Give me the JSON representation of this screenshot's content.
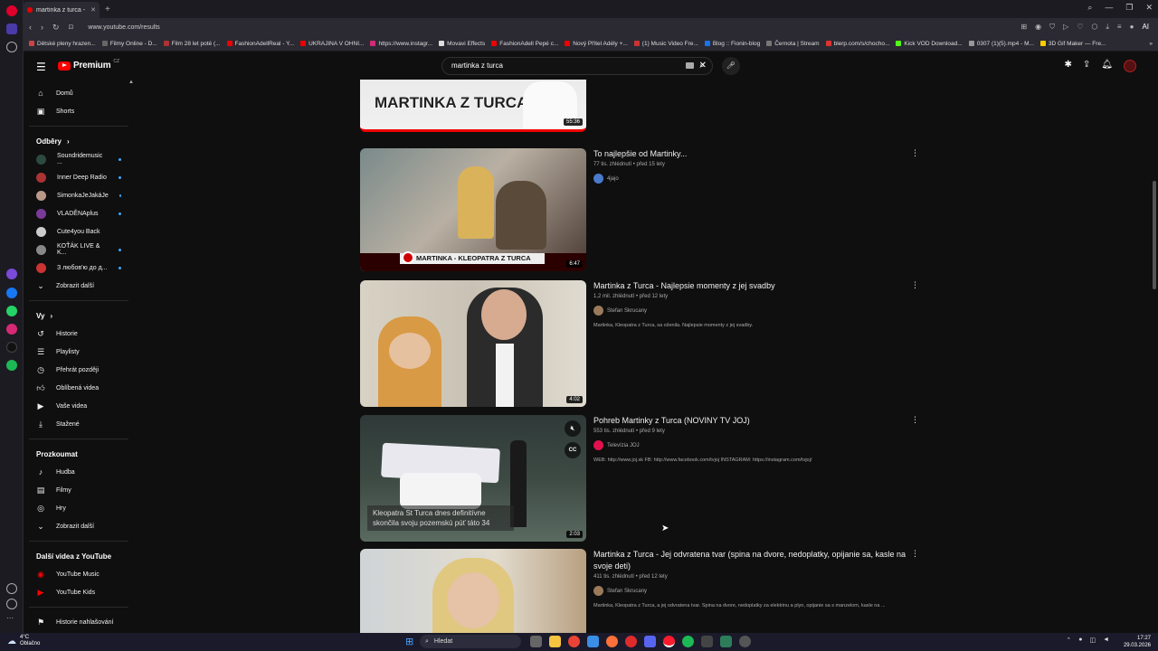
{
  "browser": {
    "tab_title": "martinka z turca - YouTub",
    "url": "www.youtube.com/results",
    "bookmarks": [
      "Dětské pleny hrazen...",
      "Filmy Online - D...",
      "Film 28 let poté (...",
      "FashionAdellReal - Y...",
      "UKRAJINA V OHNI...",
      "https://www.instagr...",
      "Movavi Effects",
      "FashionAdell Pepé c...",
      "Nový Přítel Adély +...",
      "(1) Music Video Fre...",
      "Blog :: Fionin-blog",
      "Černota | Stream",
      "blerp.com/s/chocho...",
      "Kick VOD Download...",
      "0307 (1)(5).mp4 - M...",
      "3D Gif Maker — Fre..."
    ]
  },
  "youtube": {
    "logo": "Premium",
    "logo_country": "CZ",
    "search_value": "martinka z turca"
  },
  "sidebar": {
    "main": [
      {
        "label": "Domů",
        "icon": "home-icon"
      },
      {
        "label": "Shorts",
        "icon": "shorts-icon"
      }
    ],
    "subs_heading": "Odběry",
    "subs": [
      {
        "label": "Soundridemusic ...",
        "color": "#2d4a3e"
      },
      {
        "label": "Inner Deep Radio",
        "color": "#a33"
      },
      {
        "label": "SimonkaJeJakáJe",
        "color": "#b98"
      },
      {
        "label": "VLADĚNAplus",
        "color": "#7a3a9a"
      },
      {
        "label": "Cute4you Back",
        "color": "#ccc"
      },
      {
        "label": "KOŤÁK LIVE & K...",
        "color": "#888"
      },
      {
        "label": "З любов'ю до д...",
        "color": "#c33"
      }
    ],
    "show_more": "Zobrazit další",
    "you_heading": "Vy",
    "you": [
      {
        "label": "Historie",
        "icon": "history-icon"
      },
      {
        "label": "Playlisty",
        "icon": "playlist-icon"
      },
      {
        "label": "Přehrát později",
        "icon": "clock-icon"
      },
      {
        "label": "Oblíbená videa",
        "icon": "like-icon"
      },
      {
        "label": "Vaše videa",
        "icon": "video-icon"
      },
      {
        "label": "Stažené",
        "icon": "download-icon"
      }
    ],
    "explore_heading": "Prozkoumat",
    "explore": [
      {
        "label": "Hudba",
        "icon": "music-icon"
      },
      {
        "label": "Filmy",
        "icon": "film-icon"
      },
      {
        "label": "Hry",
        "icon": "gamepad-icon"
      },
      {
        "label": "Zobrazit další",
        "icon": "chevron-down-icon"
      }
    ],
    "more_heading": "Další videa z YouTube",
    "more": [
      {
        "label": "YouTube Music",
        "icon": "yt-music-icon"
      },
      {
        "label": "YouTube Kids",
        "icon": "yt-kids-icon"
      }
    ],
    "report": "Historie nahlašování"
  },
  "results": [
    {
      "title": "",
      "stats": "",
      "channel": "",
      "desc": "",
      "duration": "55:36",
      "thumb_text": "MARTINKA Z TURCA"
    },
    {
      "title": "To najlepšie od Martinky...",
      "stats": "77 tis. zhlédnutí • před 15 lety",
      "channel": "4jajo",
      "desc": "",
      "duration": "6:47",
      "thumb_text": "MARTINKA - KLEOPATRA Z TURCA"
    },
    {
      "title": "Martinka z Turca - Najlepsie momenty z jej svadby",
      "stats": "1,2 mil. zhlédnutí • před 12 lety",
      "channel": "Stefan Skrucany",
      "desc": "Martinka, Kleopatra z Turca, sa oženila. Najlepsie momenty z jej svadby.",
      "duration": "4:02",
      "thumb_text": ""
    },
    {
      "title": "Pohreb Martinky z Turca (NOVINY TV JOJ)",
      "stats": "553 tis. zhlédnutí • před 9 lety",
      "channel": "Televízia JOJ",
      "desc": "WEB: http://www.joj.sk FB: http://www.facebook.com/tvjoj INSTAGRAM: https://instagram.com/tvjoj/",
      "duration": "2:03",
      "thumb_text": "Kleopatra St Turca dnes definitívne skončila svoju pozemskú púť táto 34"
    },
    {
      "title": "Martinka z Turca - Jej odvratena tvar (spina na dvore, nedoplatky, opijanie sa, kasle na svoje deti)",
      "stats": "411 tis. zhlédnutí • před 12 lety",
      "channel": "Stefan Skrucany",
      "desc": "Martinka, Kleopatra z Turca, a jej odvratena tvar. Spina na dvore, nedoplatky za elektrinu a plyn, opijanie sa s manzelom, kasle na ...",
      "duration": "",
      "thumb_text": ""
    }
  ],
  "taskbar": {
    "temp": "4°C",
    "weather": "Oblačno",
    "search": "Hledat",
    "time": "17:27",
    "date": "29.03.2026"
  }
}
